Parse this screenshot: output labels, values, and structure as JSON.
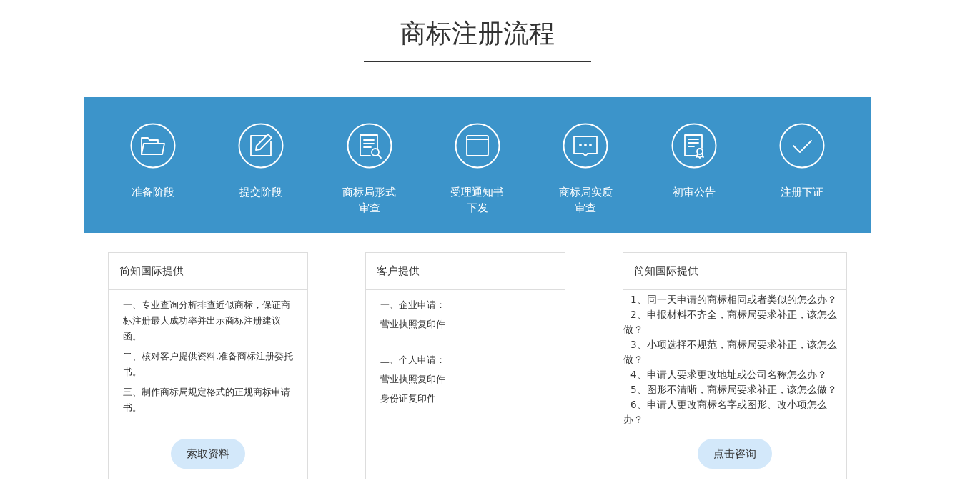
{
  "page_title": "商标注册流程",
  "steps": [
    {
      "lines": [
        "准备阶段"
      ]
    },
    {
      "lines": [
        "提交阶段"
      ]
    },
    {
      "lines": [
        "商标局形式",
        "审查"
      ]
    },
    {
      "lines": [
        "受理通知书",
        "下发"
      ]
    },
    {
      "lines": [
        "商标局实质",
        "审查"
      ]
    },
    {
      "lines": [
        "初审公告"
      ]
    },
    {
      "lines": [
        "注册下证"
      ]
    }
  ],
  "cards": [
    {
      "kind": "paragraphs",
      "title": "简知国际提供",
      "items": [
        "一、专业查询分析排查近似商标，保证商标注册最大成功率并出示商标注册建议函。",
        "二、核对客户提供资料,准备商标注册委托书。",
        "三、制作商标局规定格式的正规商标申请书。"
      ],
      "button": "索取资料"
    },
    {
      "kind": "groups",
      "title": "客户提供",
      "groups": [
        {
          "heading": "一、企业申请：",
          "items": [
            "营业执照复印件"
          ]
        },
        {
          "heading": "二、个人申请：",
          "items": [
            "营业执照复印件",
            "身份证复印件"
          ]
        }
      ]
    },
    {
      "kind": "questions",
      "title": "简知国际提供",
      "items": [
        "1、同一天申请的商标相同或者类似的怎么办？",
        "2、申报材料不齐全，商标局要求补正，该怎么做？",
        "3、小项选择不规范，商标局要求补正，该怎么做？",
        "4、申请人要求更改地址或公司名称怎么办？",
        "5、图形不清晰，商标局要求补正，该怎么做？",
        "6、申请人更改商标名字或图形、改小项怎么办？"
      ],
      "button": "点击咨询"
    }
  ]
}
